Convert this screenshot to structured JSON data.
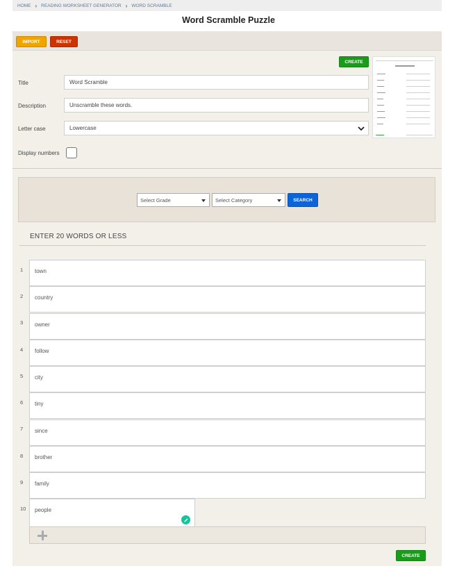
{
  "breadcrumb": {
    "items": [
      "HOME",
      "READING WORKSHEET GENERATOR",
      "WORD SCRAMBLE"
    ],
    "separator": "›"
  },
  "page": {
    "title": "Word Scramble Puzzle"
  },
  "toolbar": {
    "import_label": "IMPORT",
    "reset_label": "RESET"
  },
  "form": {
    "create_label": "CREATE",
    "title_label": "Title",
    "title_value": "Word Scramble",
    "description_label": "Description",
    "description_value": "Unscramble these words.",
    "lettercase_label": "Letter case",
    "lettercase_value": "Lowercase",
    "display_numbers_label": "Display numbers",
    "display_numbers_checked": false
  },
  "search": {
    "grade_placeholder": "Select Grade",
    "category_placeholder": "Select Category",
    "search_label": "SEARCH"
  },
  "words": {
    "heading": "ENTER 20 WORDS OR LESS",
    "items": [
      {
        "num": "1",
        "value": "town"
      },
      {
        "num": "2",
        "value": "country"
      },
      {
        "num": "3",
        "value": "owner"
      },
      {
        "num": "4",
        "value": "follow"
      },
      {
        "num": "5",
        "value": "city"
      },
      {
        "num": "6",
        "value": "tiny"
      },
      {
        "num": "7",
        "value": "since"
      },
      {
        "num": "8",
        "value": "brother"
      },
      {
        "num": "9",
        "value": "family"
      },
      {
        "num": "10",
        "value": "people"
      }
    ],
    "create_label": "CREATE"
  },
  "colors": {
    "import": "#f0a400",
    "reset": "#cc3300",
    "create": "#1a9c1a",
    "search": "#0d63d8",
    "panel": "#f3f0e9"
  },
  "icons": [
    "chevron-right-icon",
    "select-caret-icon",
    "plus-icon",
    "grammarly-icon"
  ]
}
